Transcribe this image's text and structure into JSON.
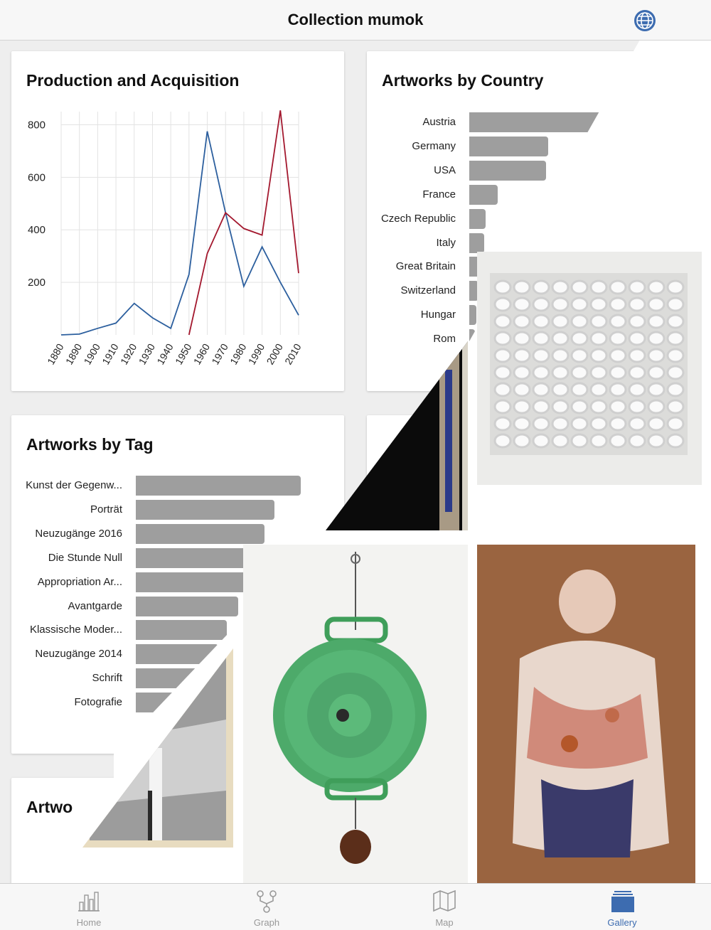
{
  "navbar": {
    "title": "Collection mumok",
    "globe_icon": "globe-icon"
  },
  "cards": {
    "production": {
      "title": "Production and Acquisition",
      "chart_data": {
        "type": "line",
        "title": "Production and Acquisition",
        "x": [
          1880,
          1890,
          1900,
          1910,
          1920,
          1930,
          1940,
          1950,
          1960,
          1970,
          1980,
          1990,
          2000,
          2010
        ],
        "xticks": [
          "1880",
          "1890",
          "1900",
          "1910",
          "1920",
          "1930",
          "1940",
          "1950",
          "1960",
          "1970",
          "1980",
          "1990",
          "2000",
          "2010"
        ],
        "yticks": [
          "200",
          "400",
          "600",
          "800"
        ],
        "ylim": [
          0,
          850
        ],
        "grid": true,
        "series": [
          {
            "color": "#2c5f9e",
            "values": [
              0,
              3,
              25,
              45,
              120,
              65,
              25,
              230,
              775,
              465,
              185,
              335,
              200,
              75
            ]
          },
          {
            "color": "#a3182e",
            "values": [
              null,
              null,
              null,
              null,
              null,
              null,
              null,
              0,
              310,
              465,
              405,
              380,
              855,
              235
            ]
          }
        ]
      }
    },
    "country": {
      "title": "Artworks by Country",
      "rows": [
        {
          "label": "Austria",
          "value": 1.0
        },
        {
          "label": "Germany",
          "value": 0.58
        },
        {
          "label": "USA",
          "value": 0.56
        },
        {
          "label": "France",
          "value": 0.21
        },
        {
          "label": "Czech Republic",
          "value": 0.12
        },
        {
          "label": "Italy",
          "value": 0.11
        },
        {
          "label": "Great Britain",
          "value": 0.085
        },
        {
          "label": "Switzerland",
          "value": 0.07
        },
        {
          "label": "Hungar",
          "value": 0.05
        },
        {
          "label": "Rom",
          "value": 0.04
        }
      ]
    },
    "tag": {
      "title": "Artworks by Tag",
      "rows": [
        {
          "label": "Kunst der Gegenw...",
          "value": 1.0
        },
        {
          "label": "Porträt",
          "value": 0.84
        },
        {
          "label": "Neuzugänge 2016",
          "value": 0.78
        },
        {
          "label": "Die Stunde Null",
          "value": 0.75
        },
        {
          "label": "Appropriation Ar...",
          "value": 0.7
        },
        {
          "label": "Avantgarde",
          "value": 0.62
        },
        {
          "label": "Klassische Moder...",
          "value": 0.55
        },
        {
          "label": "Neuzugänge 2014",
          "value": 0.5
        },
        {
          "label": "Schrift",
          "value": 0.45
        },
        {
          "label": "Fotografie",
          "value": 0.35
        }
      ]
    },
    "fourth": {
      "title": "Artwo"
    }
  },
  "tabs": [
    {
      "label": "Home",
      "icon": "bar-chart-icon",
      "active": false
    },
    {
      "label": "Graph",
      "icon": "graph-icon",
      "active": false
    },
    {
      "label": "Map",
      "icon": "map-icon",
      "active": false
    },
    {
      "label": "Gallery",
      "icon": "gallery-icon",
      "active": true
    }
  ],
  "colors": {
    "accent": "#3d6cb0",
    "bar": "#9e9e9e",
    "production_line": "#2c5f9e",
    "acquisition_line": "#a3182e"
  }
}
